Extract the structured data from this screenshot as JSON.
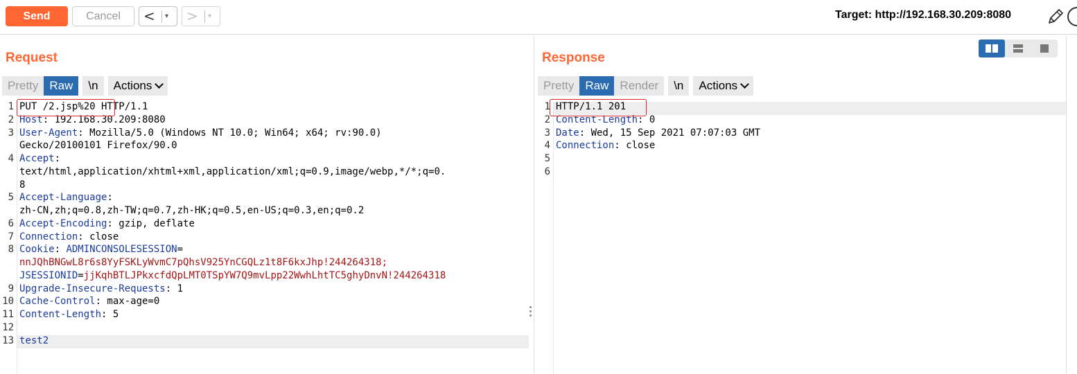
{
  "toolbar": {
    "send_label": "Send",
    "cancel_label": "Cancel",
    "back_arrow": "<",
    "forward_arrow": ">",
    "dropdown_glyph": "▾",
    "target_label": "Target: http://192.168.30.209:8080"
  },
  "request": {
    "title": "Request",
    "tabs": [
      "Pretty",
      "Raw",
      "\\n",
      "Actions"
    ],
    "active_tab": "Raw"
  },
  "response": {
    "title": "Response",
    "tabs": [
      "Pretty",
      "Raw",
      "Render",
      "\\n",
      "Actions"
    ],
    "active_tab": "Raw"
  },
  "line_numbers_request": [
    "1",
    "2",
    "3",
    "",
    "4",
    "",
    "",
    "5",
    "",
    "6",
    "7",
    "8",
    "",
    "",
    "9",
    "10",
    "11",
    "12",
    "13"
  ],
  "line_numbers_response": [
    "1",
    "2",
    "3",
    "4",
    "5",
    "6"
  ],
  "request_lines": [
    [
      {
        "t": "PUT /2.jsp%20 HTTP/1.1",
        "c": "v"
      }
    ],
    [
      {
        "t": "Host",
        "c": "k"
      },
      {
        "t": ": 192.168.30.209:8080",
        "c": "v"
      }
    ],
    [
      {
        "t": "User-Agent",
        "c": "k"
      },
      {
        "t": ": Mozilla/5.0 (Windows NT 10.0; Win64; x64; rv:90.0)",
        "c": "v"
      }
    ],
    [
      {
        "t": "Gecko/20100101 Firefox/90.0",
        "c": "v"
      }
    ],
    [
      {
        "t": "Accept",
        "c": "k"
      },
      {
        "t": ":",
        "c": "v"
      }
    ],
    [
      {
        "t": "text/html,application/xhtml+xml,application/xml;q=0.9,image/webp,*/*;q=0.",
        "c": "v"
      }
    ],
    [
      {
        "t": "8",
        "c": "v"
      }
    ],
    [
      {
        "t": "Accept-Language",
        "c": "k"
      },
      {
        "t": ":",
        "c": "v"
      }
    ],
    [
      {
        "t": "zh-CN,zh;q=0.8,zh-TW;q=0.7,zh-HK;q=0.5,en-US;q=0.3,en;q=0.2",
        "c": "v"
      }
    ],
    [
      {
        "t": "Accept-Encoding",
        "c": "k"
      },
      {
        "t": ": gzip, deflate",
        "c": "v"
      }
    ],
    [
      {
        "t": "Connection",
        "c": "k"
      },
      {
        "t": ": close",
        "c": "v"
      }
    ],
    [
      {
        "t": "Cookie",
        "c": "k"
      },
      {
        "t": ": ",
        "c": "v"
      },
      {
        "t": "ADMINCONSOLESESSION",
        "c": "k"
      },
      {
        "t": "=",
        "c": "v"
      }
    ],
    [
      {
        "t": "nnJQhBNGwL8r6s8YyFSKLyWvmC7pQhsV925YnCGQLz1t8F6kxJhp!244264318;",
        "c": "r"
      }
    ],
    [
      {
        "t": "JSESSIONID",
        "c": "k"
      },
      {
        "t": "=",
        "c": "v"
      },
      {
        "t": "jjKqhBTLJPkxcfdQpLMT0TSpYW7Q9mvLpp22WwhLhtTC5ghyDnvN!244264318",
        "c": "r"
      }
    ],
    [
      {
        "t": "Upgrade-Insecure-Requests",
        "c": "k"
      },
      {
        "t": ": 1",
        "c": "v"
      }
    ],
    [
      {
        "t": "Cache-Control",
        "c": "k"
      },
      {
        "t": ": max-age=0",
        "c": "v"
      }
    ],
    [
      {
        "t": "Content-Length",
        "c": "k"
      },
      {
        "t": ": 5",
        "c": "v"
      }
    ],
    [
      {
        "t": "",
        "c": "v"
      }
    ],
    [
      {
        "t": "test2",
        "c": "k"
      }
    ]
  ],
  "response_lines": [
    [
      {
        "t": "HTTP/1.1 201",
        "c": "v"
      }
    ],
    [
      {
        "t": "Content-Length",
        "c": "k"
      },
      {
        "t": ": 0",
        "c": "v"
      }
    ],
    [
      {
        "t": "Date",
        "c": "k"
      },
      {
        "t": ": Wed, 15 Sep 2021 07:07:03 GMT",
        "c": "v"
      }
    ],
    [
      {
        "t": "Connection",
        "c": "k"
      },
      {
        "t": ": close",
        "c": "v"
      }
    ],
    [
      {
        "t": "",
        "c": "v"
      }
    ],
    [
      {
        "t": "",
        "c": "v"
      }
    ]
  ],
  "colors": {
    "accent": "#ff6633",
    "active_tab": "#2b6cb0",
    "header_key": "#1a3b9c",
    "cookie_value": "#a31515",
    "highlight_box": "#d9262c"
  },
  "icons": [
    "pencil-icon",
    "help-icon",
    "layout-split-icon",
    "layout-horizontal-icon",
    "layout-tabs-icon",
    "drag-handle-icon"
  ]
}
